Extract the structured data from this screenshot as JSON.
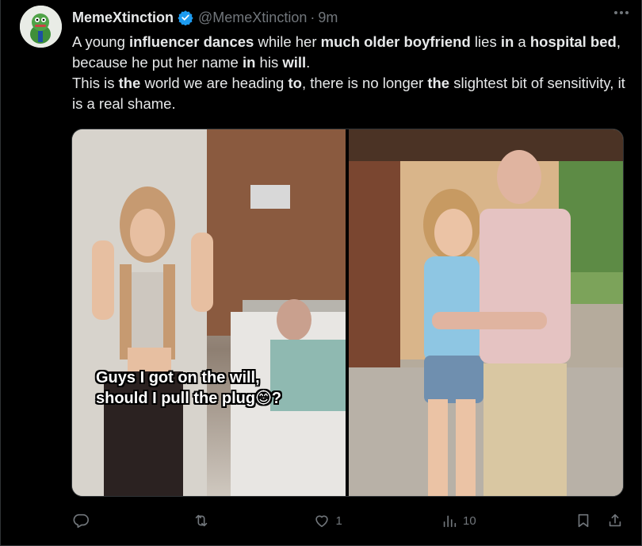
{
  "author": {
    "display_name": "MemeXtinction",
    "handle": "@MemeXtinction",
    "separator": "·",
    "time": "9m",
    "verified": true,
    "avatar_icon": "frog-avatar-icon"
  },
  "tweet": {
    "line1": [
      {
        "t": "A young ",
        "b": false
      },
      {
        "t": "influencer dances",
        "b": true
      },
      {
        "t": " while her ",
        "b": false
      },
      {
        "t": "much older boyfriend",
        "b": true
      },
      {
        "t": " lies ",
        "b": false
      },
      {
        "t": "in",
        "b": true
      },
      {
        "t": " a ",
        "b": false
      },
      {
        "t": "hospital bed",
        "b": true
      },
      {
        "t": ", because he put her name ",
        "b": false
      },
      {
        "t": "in",
        "b": true
      },
      {
        "t": " his ",
        "b": false
      },
      {
        "t": "will",
        "b": true
      },
      {
        "t": ".",
        "b": false
      }
    ],
    "line2": [
      {
        "t": "This is ",
        "b": false
      },
      {
        "t": "the",
        "b": true
      },
      {
        "t": " world we are heading ",
        "b": false
      },
      {
        "t": "to",
        "b": true
      },
      {
        "t": ", there is no longer ",
        "b": false
      },
      {
        "t": "the",
        "b": true
      },
      {
        "t": " slightest bit of sensitivity, it is a real shame.",
        "b": false
      }
    ]
  },
  "media": {
    "caption_line1": "Guys I got on the will,",
    "caption_line2": "should I pull the plug😊?"
  },
  "actions": {
    "reply_count": "",
    "retweet_count": "",
    "like_count": "1",
    "views_count": "10"
  },
  "colors": {
    "background": "#000000",
    "text": "#e7e9ea",
    "muted": "#71767b",
    "verified": "#1d9bf0"
  }
}
